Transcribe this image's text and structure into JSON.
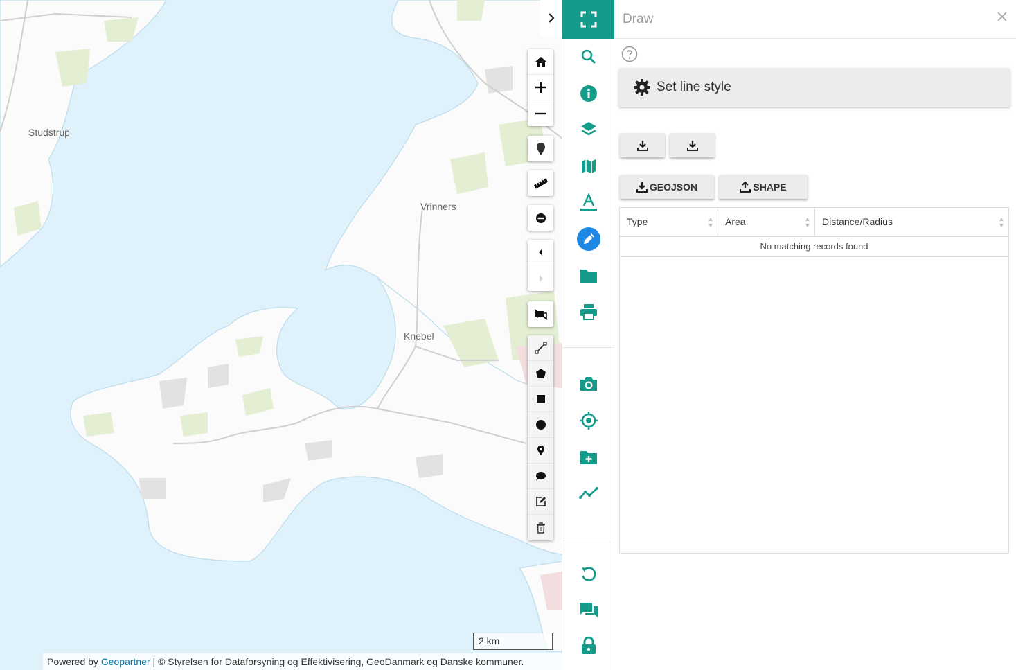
{
  "map": {
    "labels": {
      "studstrup": "Studstrup",
      "vrinners": "Vrinners",
      "knebel": "Knebel"
    },
    "scale_label": "2 km",
    "attribution": {
      "prefix": "Powered by ",
      "link": "Geopartner",
      "suffix": " | © Styrelsen for Dataforsyning og Effektivisering, GeoDanmark og Danske kommuner."
    },
    "colors": {
      "water": "#dff1fb",
      "land": "#fbfbfb",
      "forest": "#e3eed2",
      "urban": "#e2e2e2"
    }
  },
  "map_toolbar": {
    "nav": [
      "home-icon",
      "zoom-in-icon",
      "zoom-out-icon"
    ],
    "tools": [
      "marker-icon",
      "ruler-icon",
      "no-entry-icon"
    ],
    "history": [
      "back-icon",
      "forward-icon"
    ],
    "draw_tools": [
      "line-icon",
      "polygon-icon",
      "rectangle-icon",
      "circle-icon",
      "point-icon",
      "comment-icon",
      "edit-icon",
      "trash-icon"
    ]
  },
  "iconbar": {
    "accent": "#159b8a",
    "active_color": "#1e88e5",
    "items": [
      "fullscreen-icon",
      "search-icon",
      "info-icon",
      "layers-icon",
      "map-icon",
      "text-icon",
      "draw-pencil-icon",
      "folder-icon",
      "print-icon",
      "camera-icon",
      "locate-icon",
      "folder-add-icon",
      "chart-line-icon",
      "reset-icon",
      "chat-icon",
      "lock-icon"
    ]
  },
  "panel": {
    "title": "Draw",
    "set_line_style": "Set line style",
    "geojson_button": "GEOJSON",
    "shape_button": "SHAPE",
    "table": {
      "columns": [
        "Type",
        "Area",
        "Distance/Radius"
      ],
      "empty_message": "No matching records found"
    }
  }
}
